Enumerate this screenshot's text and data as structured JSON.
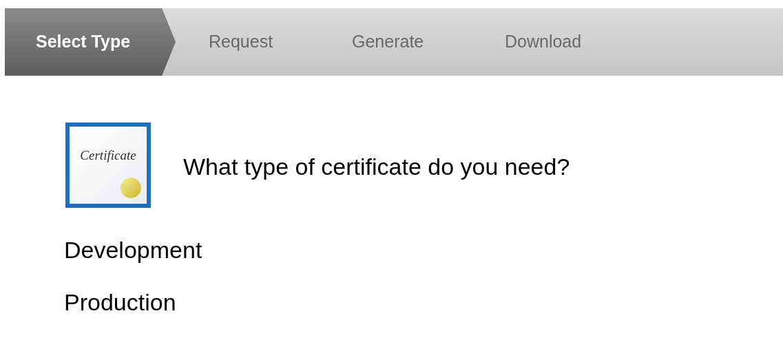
{
  "steps": [
    {
      "label": "Select Type",
      "selected": true
    },
    {
      "label": "Request",
      "selected": false
    },
    {
      "label": "Generate",
      "selected": false
    },
    {
      "label": "Download",
      "selected": false
    }
  ],
  "icon_caption": "Certificate",
  "heading": "What type of certificate do you need?",
  "options": [
    {
      "label": "Development"
    },
    {
      "label": "Production"
    }
  ]
}
